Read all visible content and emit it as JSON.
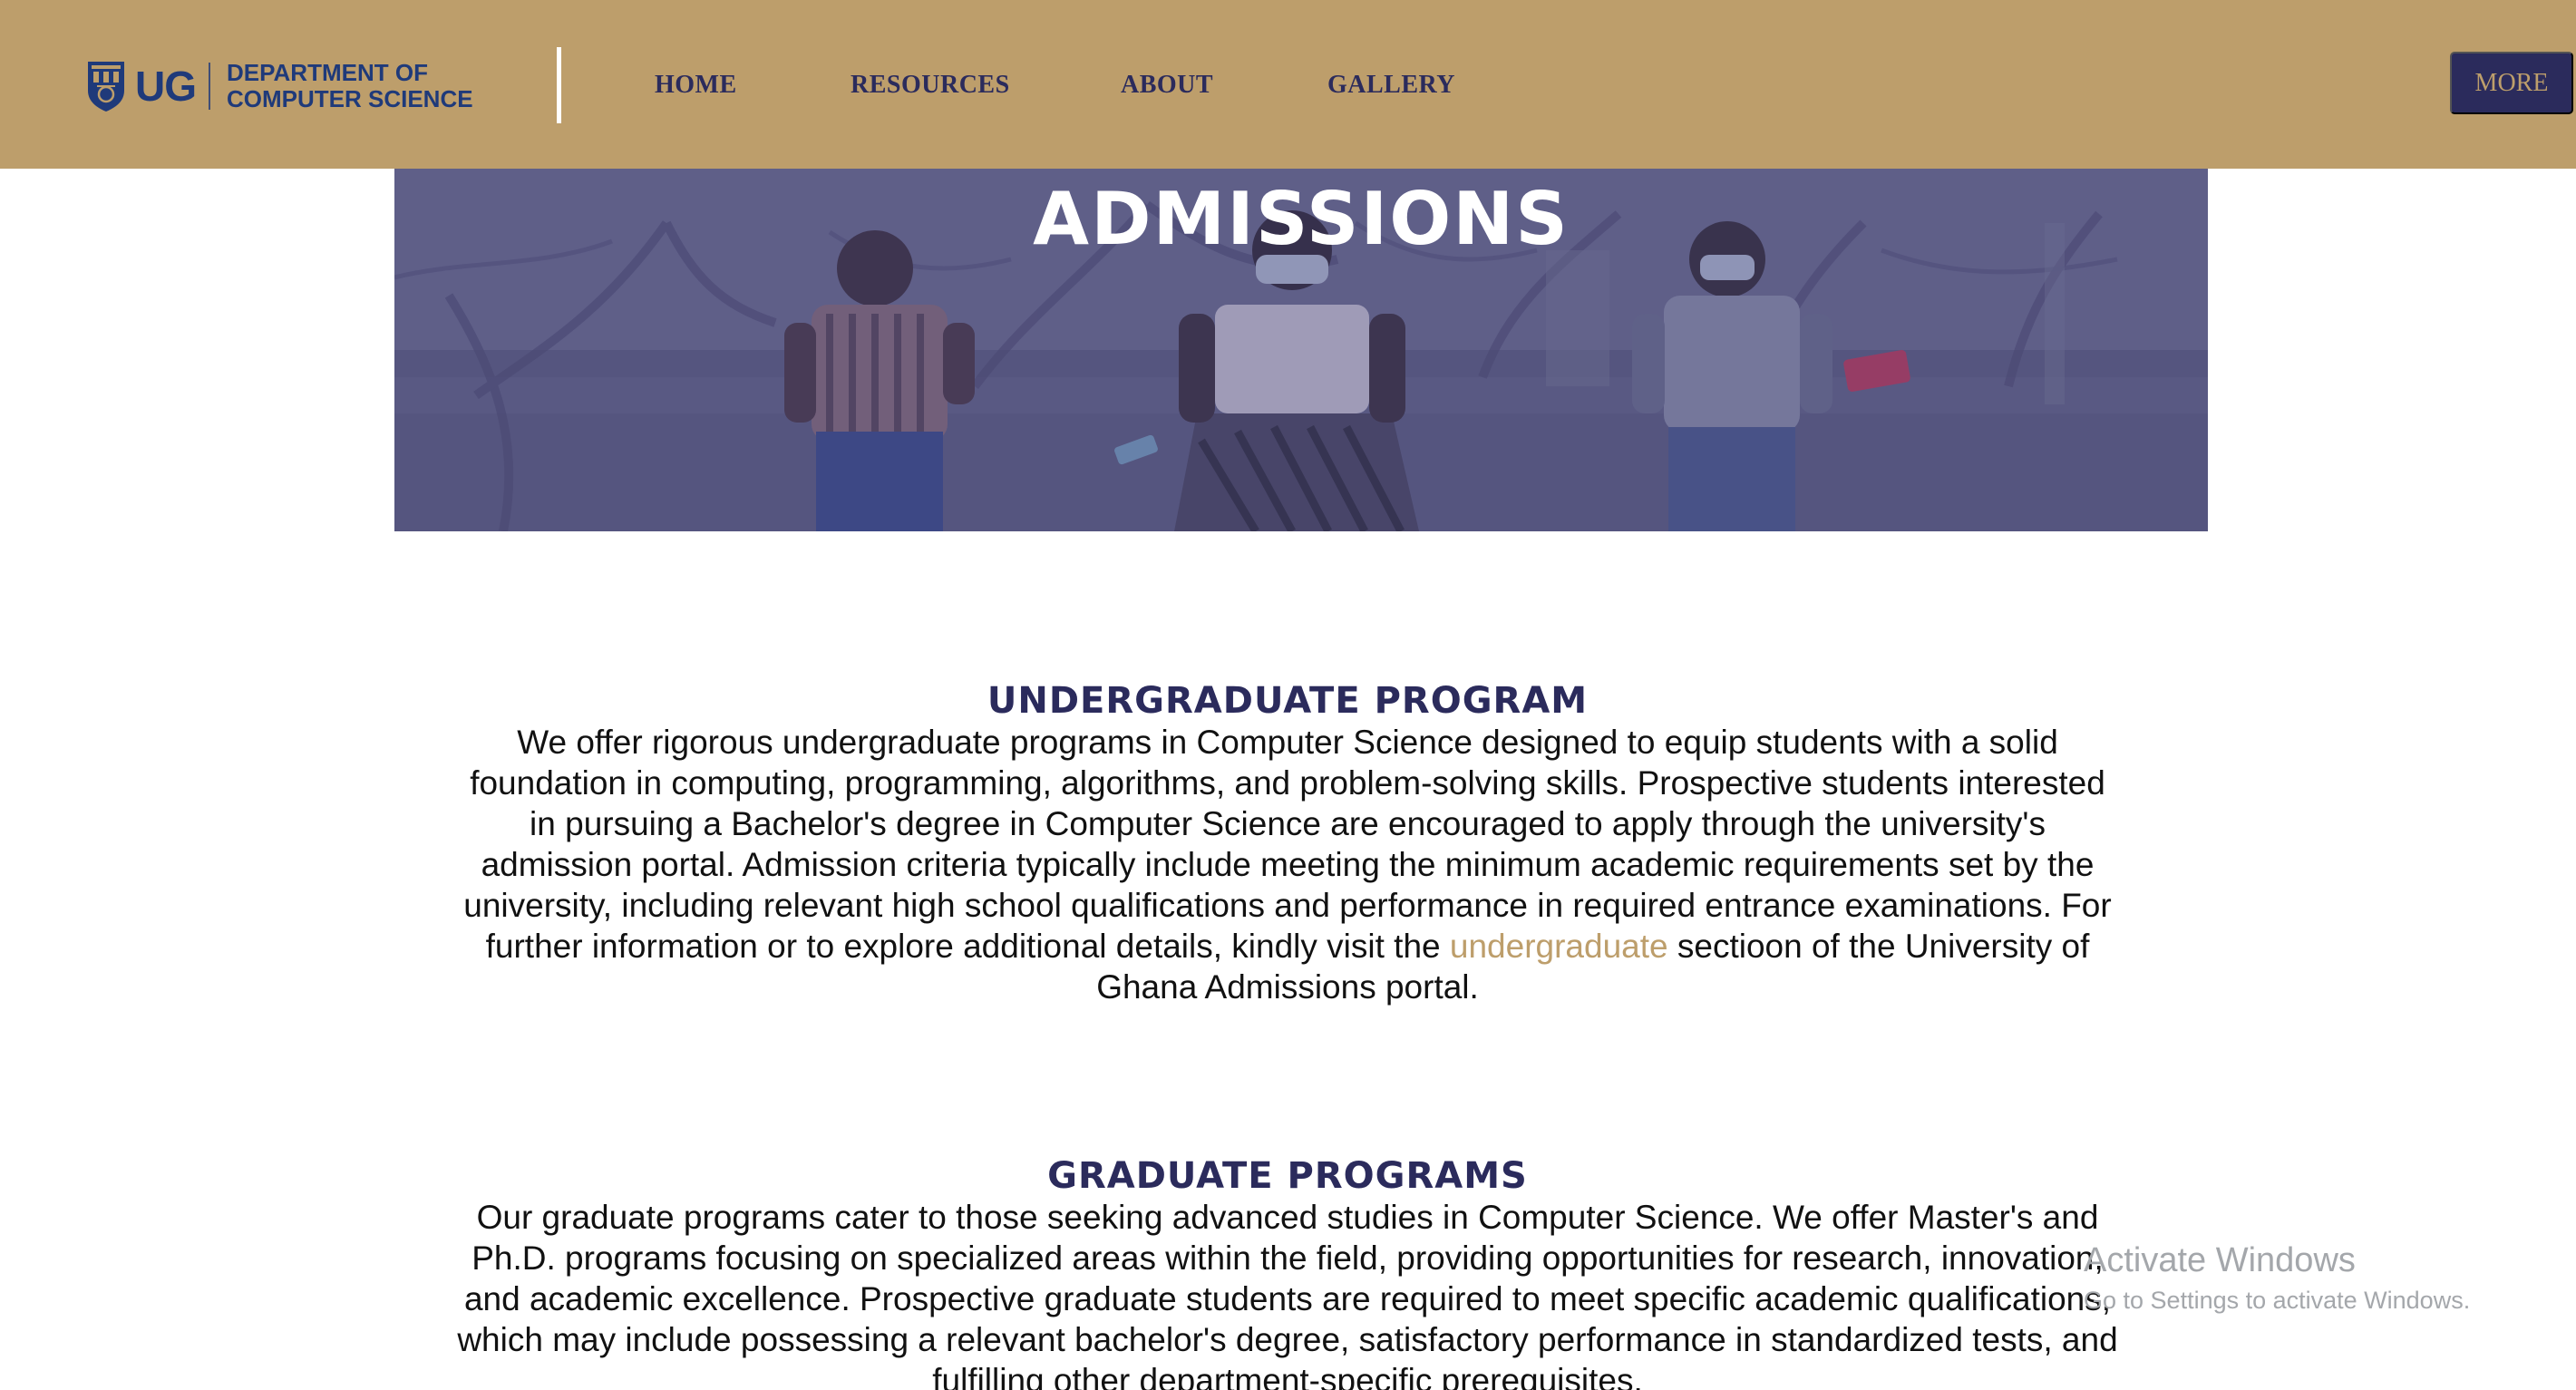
{
  "header": {
    "logo": {
      "mark": "UG",
      "line1": "DEPARTMENT OF",
      "line2": "COMPUTER SCIENCE",
      "icon": "university-crest-icon"
    },
    "nav": [
      {
        "label": "HOME"
      },
      {
        "label": "RESOURCES"
      },
      {
        "label": "ABOUT"
      },
      {
        "label": "GALLERY"
      }
    ],
    "more_label": "MORE"
  },
  "hero": {
    "title": "ADMISSIONS"
  },
  "undergraduate": {
    "heading": "UNDERGRADUATE PROGRAM",
    "text_before_link": "We offer rigorous undergraduate programs in Computer Science designed to equip students with a solid foundation in computing, programming, algorithms, and problem-solving skills. Prospective students interested in pursuing a Bachelor's degree in Computer Science are encouraged to apply through the university's admission portal. Admission criteria typically include meeting the minimum academic requirements set by the university, including relevant high school qualifications and performance in required entrance examinations. For further information or to explore additional details, kindly visit the ",
    "link_text": "undergraduate",
    "text_after_link": " sectioon of the University of Ghana Admissions portal."
  },
  "graduate": {
    "heading": "GRADUATE PROGRAMS",
    "text": "Our graduate programs cater to those seeking advanced studies in Computer Science. We offer Master's and Ph.D. programs focusing on specialized areas within the field, providing opportunities for research, innovation, and academic excellence. Prospective graduate students are required to meet specific academic qualifications, which may include possessing a relevant bachelor's degree, satisfactory performance in standardized tests, and fulfilling other department-specific prerequisites."
  },
  "watermark": {
    "title": "Activate Windows",
    "subtitle": "Go to Settings to activate Windows."
  },
  "colors": {
    "header_bg": "#bd9e6b",
    "navy": "#2b2b5c",
    "logo_blue": "#1f3a7a",
    "link": "#bd9e6b"
  }
}
